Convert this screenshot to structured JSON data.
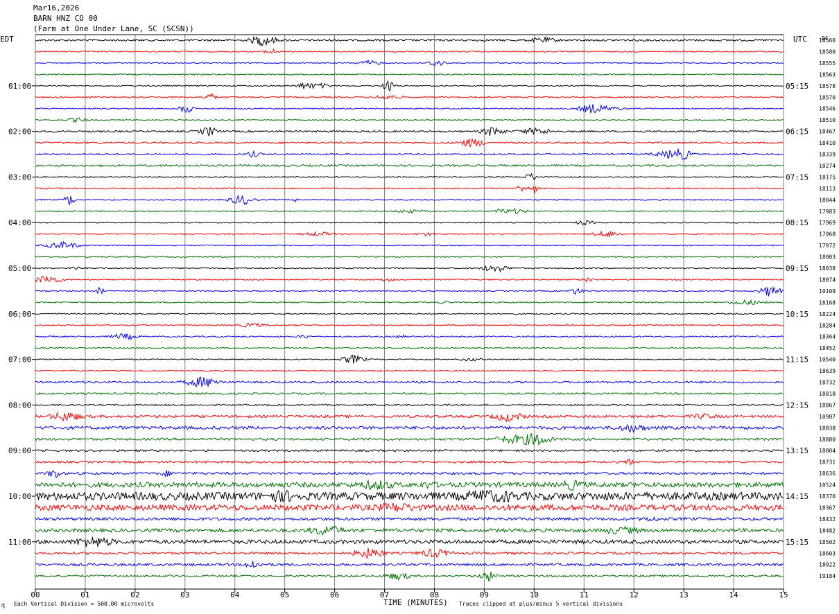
{
  "header": {
    "date": "Mar16,2026",
    "station": "BARN HNZ CO 00",
    "location": "(Farm at One Under Lane, SC (SCSN))"
  },
  "timezones": {
    "left": "EDT",
    "right": "UTC",
    "dc_label": "DC"
  },
  "footer": {
    "vertical_division": "Each Vertical Division =  500.00 microvolts",
    "xlabel": "TIME (MINUTES)",
    "clip_note": "Traces clipped at plus/minus 5 vertical divisions"
  },
  "colors": {
    "trace_cycle": [
      "#000000",
      "#ff0000",
      "#0000ff",
      "#007000"
    ],
    "grid": "#808080"
  },
  "chart_data": {
    "type": "line",
    "x": {
      "range": [
        0,
        15
      ],
      "unit": "minutes",
      "tick_labels": [
        "00",
        "01",
        "02",
        "03",
        "04",
        "05",
        "06",
        "07",
        "08",
        "09",
        "10",
        "11",
        "12",
        "13",
        "14",
        "15"
      ]
    },
    "left_hour_labels": [
      "01:00",
      "02:00",
      "03:00",
      "04:00",
      "05:00",
      "06:00",
      "07:00",
      "08:00",
      "09:00",
      "10:00",
      "11:00"
    ],
    "right_hour_labels": [
      "05:15",
      "06:15",
      "07:15",
      "08:15",
      "09:15",
      "10:15",
      "11:15",
      "12:15",
      "13:15",
      "14:15",
      "15:15"
    ],
    "dc_offsets": [
      18560,
      18580,
      18555,
      18563,
      18578,
      18570,
      18546,
      18510,
      18467,
      18410,
      18339,
      10274,
      18175,
      18113,
      18044,
      17983,
      17969,
      17968,
      17972,
      18003,
      18038,
      18074,
      10109,
      18168,
      18224,
      18284,
      18364,
      18452,
      10540,
      18639,
      18732,
      18818,
      18867,
      10907,
      18838,
      18880,
      18804,
      18731,
      18636,
      10524,
      18370,
      18367,
      18432,
      18482,
      18502,
      18603,
      18922,
      19184
    ],
    "trace_activity": [
      1.0,
      0.6,
      0.5,
      0.6,
      0.6,
      0.7,
      0.6,
      0.5,
      0.9,
      0.9,
      0.8,
      1.0,
      0.6,
      0.7,
      0.6,
      0.6,
      0.6,
      0.5,
      0.5,
      0.6,
      0.6,
      0.6,
      0.6,
      0.6,
      0.6,
      0.6,
      0.7,
      0.6,
      0.6,
      0.6,
      1.0,
      0.9,
      0.8,
      1.3,
      1.6,
      1.2,
      1.0,
      1.1,
      1.2,
      2.5,
      4.0,
      3.0,
      1.5,
      1.8,
      2.0,
      1.2,
      1.3,
      1.0
    ]
  }
}
